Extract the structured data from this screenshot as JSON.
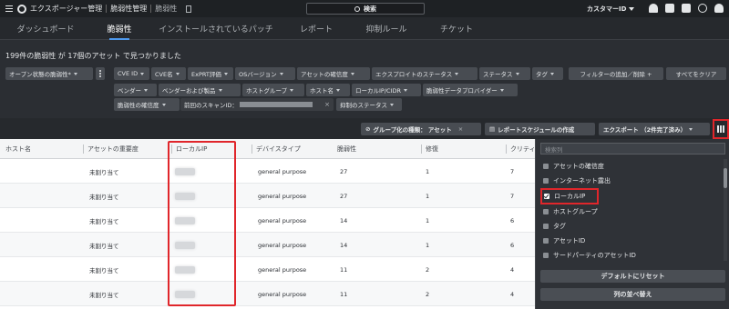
{
  "topbar": {
    "app_title": "エクスポージャー管理",
    "section": "脆弱性管理",
    "page": "脆弱性",
    "search_label": "検索",
    "customer_label": "カスタマーID"
  },
  "tabs": [
    "ダッシュボード",
    "脆弱性",
    "インストールされているパッチ",
    "レポート",
    "抑制ルール",
    "チケット"
  ],
  "summary": "199件の脆弱性 が 17個のアセット で見つかりました",
  "filters": {
    "open_state": "オープン状態の脆弱性*",
    "row1": [
      "CVE ID",
      "CVE名",
      "ExPRT評価",
      "OSバージョン",
      "アセットの確信度",
      "エクスプロイトのステータス",
      "ステータス",
      "タグ"
    ],
    "add_filter": "フィルターの追加／削除 +",
    "clear_all": "すべてをクリア",
    "row2": [
      "ベンダー",
      "ベンダーおよび製品",
      "ホストグループ",
      "ホスト名",
      "ローカルIP/CIDR",
      "脆弱性データプロバイダー"
    ],
    "confidence": "脆弱性の確信度",
    "last_scan_label": "前回のスキャンID：",
    "suppression": "抑制のステータス"
  },
  "toolbar": {
    "group_by": "グループ化の種類：  アセット",
    "group_clear": "×",
    "schedule": "レポートスケジュールの作成",
    "export": "エクスポート （2件完了済み）"
  },
  "table": {
    "headers": [
      "ホスト名",
      "アセットの重要度",
      "ローカルIP",
      "デバイスタイプ",
      "脆弱性",
      "修復",
      "クリティ"
    ],
    "rows": [
      {
        "criticality": "未割り当て",
        "device": "general purpose",
        "vulns": "27",
        "remediation": "1",
        "critical": "7"
      },
      {
        "criticality": "未割り当て",
        "device": "general purpose",
        "vulns": "27",
        "remediation": "1",
        "critical": "7"
      },
      {
        "criticality": "未割り当て",
        "device": "general purpose",
        "vulns": "14",
        "remediation": "1",
        "critical": "6"
      },
      {
        "criticality": "未割り当て",
        "device": "general purpose",
        "vulns": "14",
        "remediation": "1",
        "critical": "6"
      },
      {
        "criticality": "未割り当て",
        "device": "general purpose",
        "vulns": "11",
        "remediation": "2",
        "critical": "4"
      },
      {
        "criticality": "未割り当て",
        "device": "general purpose",
        "vulns": "11",
        "remediation": "2",
        "critical": "4"
      }
    ]
  },
  "column_panel": {
    "search_placeholder": "検索列",
    "items": [
      {
        "label": "アセットの確信度",
        "checked": false
      },
      {
        "label": "インターネット露出",
        "checked": false
      },
      {
        "label": "ローカルIP",
        "checked": true
      },
      {
        "label": "ホストグループ",
        "checked": false
      },
      {
        "label": "タグ",
        "checked": false
      },
      {
        "label": "アセットID",
        "checked": false
      },
      {
        "label": "サードパーティのアセットID",
        "checked": false
      }
    ],
    "reset": "デフォルトにリセット",
    "reorder": "列の並べ替え"
  },
  "colors": {
    "accent": "#4f9bf0",
    "highlight": "#e0262b"
  }
}
